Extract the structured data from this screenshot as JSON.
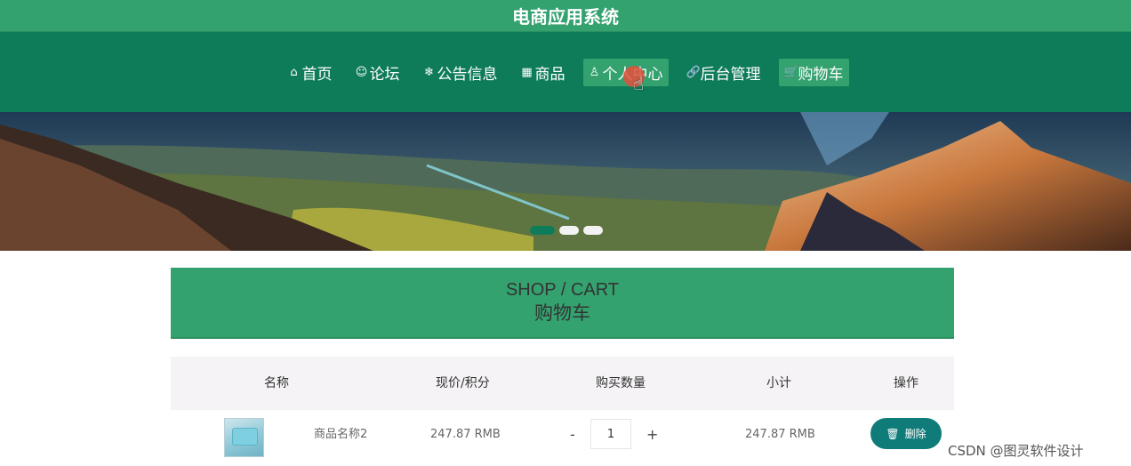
{
  "app": {
    "title": "电商应用系统"
  },
  "nav": {
    "items": [
      {
        "icon": "home-icon",
        "glyph": "⌂",
        "label": "首页"
      },
      {
        "icon": "forum-icon",
        "glyph": "☺",
        "label": "论坛"
      },
      {
        "icon": "notice-icon",
        "glyph": "❄",
        "label": "公告信息"
      },
      {
        "icon": "goods-icon",
        "glyph": "▦",
        "label": "商品"
      },
      {
        "icon": "user-icon",
        "glyph": "♙",
        "label": "个人中心"
      },
      {
        "icon": "link-icon",
        "glyph": "🔗",
        "label": "后台管理"
      },
      {
        "icon": "cart-icon",
        "glyph": "🛒",
        "label": "购物车"
      }
    ]
  },
  "banner": {
    "slides": 3,
    "active_slide": 1
  },
  "section": {
    "title_en": "SHOP / CART",
    "title_cn": "购物车"
  },
  "table": {
    "headers": [
      "名称",
      "现价/积分",
      "购买数量",
      "小计",
      "操作"
    ],
    "rows": [
      {
        "name": "商品名称2",
        "price": "247.87 RMB",
        "quantity": "1",
        "minus": "-",
        "plus": "+",
        "subtotal": "247.87 RMB",
        "delete_label": "删除"
      }
    ]
  },
  "watermark": "CSDN @图灵软件设计",
  "colors": {
    "primary": "#34a26f",
    "nav_bg": "#0f7c59",
    "delete_btn": "#0f7c79"
  }
}
